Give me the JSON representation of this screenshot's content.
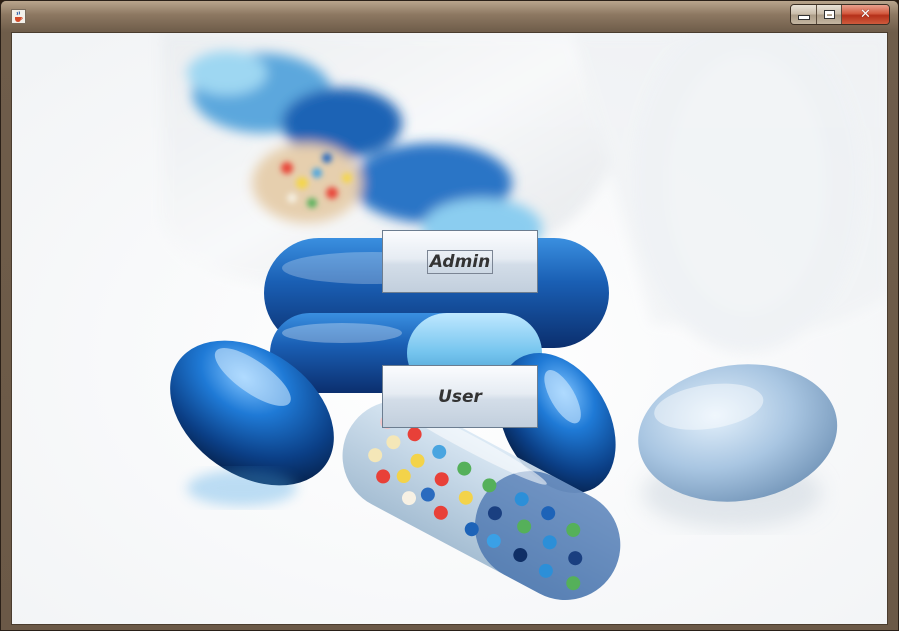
{
  "window": {
    "title": "",
    "controls": {
      "minimize_icon": "minimize-icon",
      "maximize_icon": "maximize-icon",
      "close_icon": "close-icon",
      "close_glyph": "✕"
    },
    "app_icon": "java-cup-icon"
  },
  "main": {
    "background_image": "medicine-capsules-photo",
    "buttons": {
      "admin_label": "Admin",
      "user_label": "User"
    }
  },
  "colors": {
    "title_bar": "#8d7862",
    "close_button": "#c8462b",
    "button_face": "#dfe6ee",
    "capsule_blue": "#1e5fae"
  }
}
